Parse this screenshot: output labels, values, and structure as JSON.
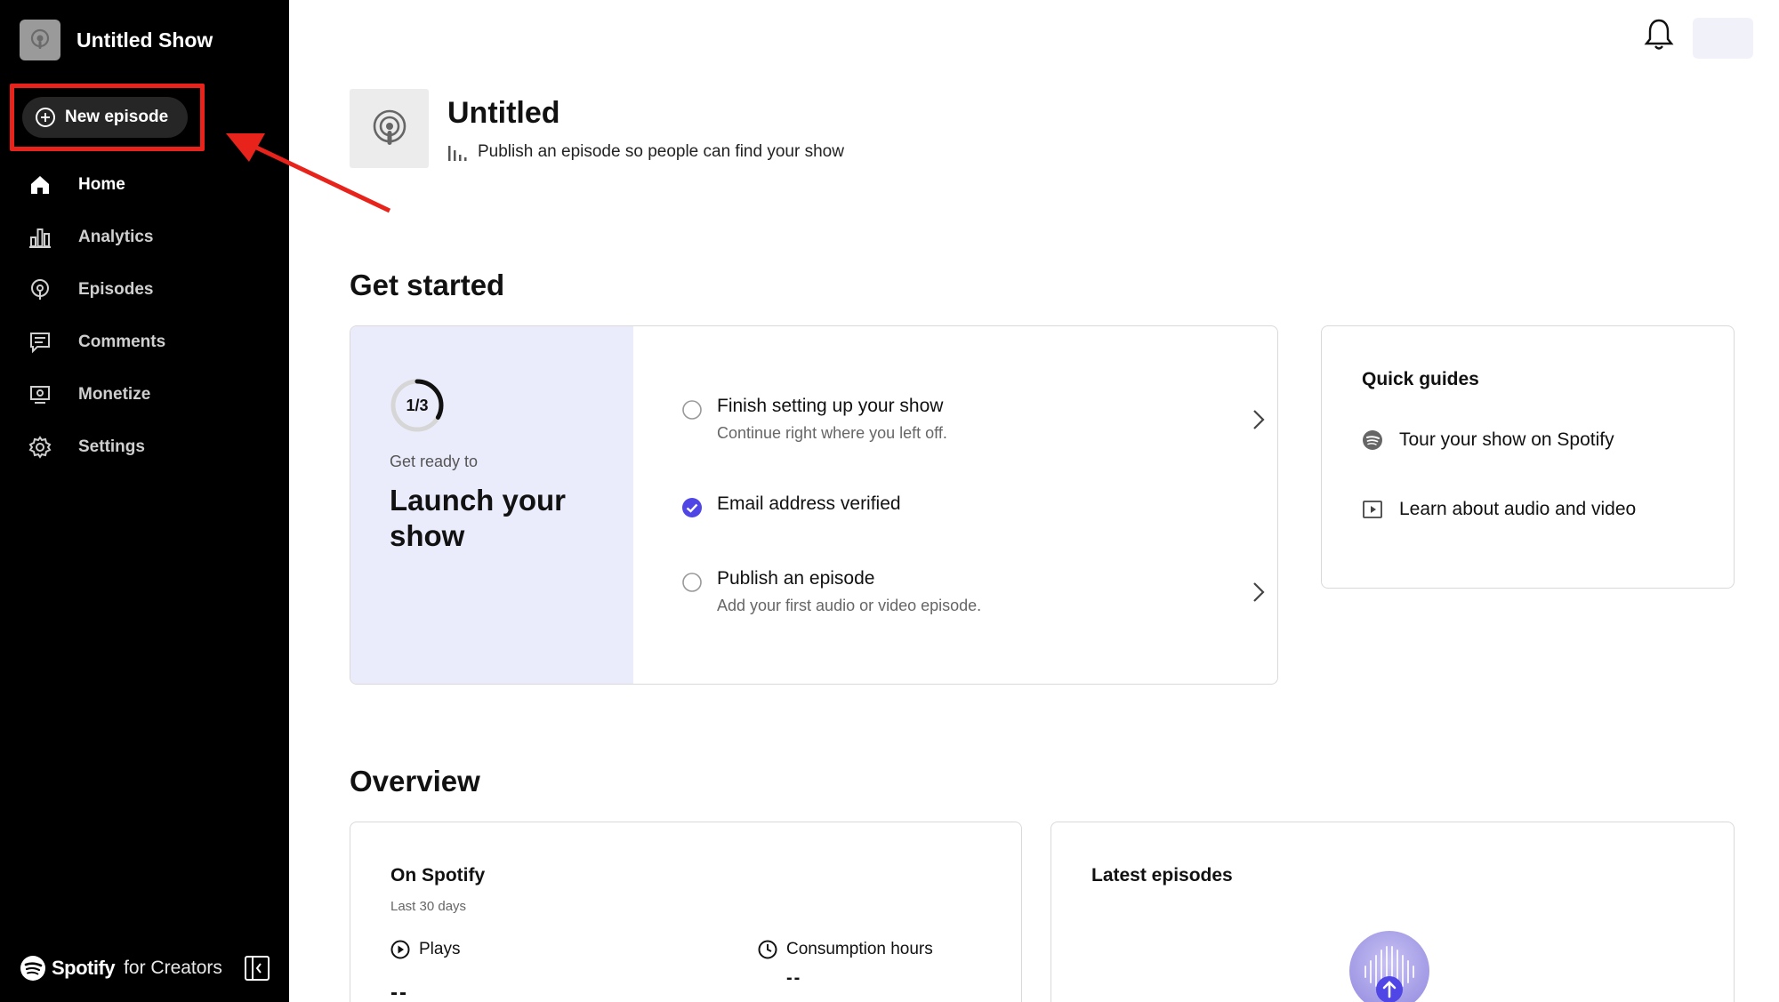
{
  "sidebar": {
    "show_title": "Untitled Show",
    "new_episode_label": "New episode",
    "items": [
      {
        "label": "Home",
        "icon": "home-icon",
        "active": true
      },
      {
        "label": "Analytics",
        "icon": "analytics-icon",
        "active": false
      },
      {
        "label": "Episodes",
        "icon": "episodes-icon",
        "active": false
      },
      {
        "label": "Comments",
        "icon": "comments-icon",
        "active": false
      },
      {
        "label": "Monetize",
        "icon": "monetize-icon",
        "active": false
      },
      {
        "label": "Settings",
        "icon": "gear-icon",
        "active": false
      }
    ],
    "brand_main": "Spotify",
    "brand_suffix": "for Creators"
  },
  "show": {
    "name": "Untitled",
    "status": "Publish an episode so people can find your show"
  },
  "get_started": {
    "title": "Get started",
    "progress": "1/3",
    "progress_fraction": 0.333,
    "kicker": "Get ready to",
    "heading": "Launch your show",
    "tasks": [
      {
        "title": "Finish setting up your show",
        "subtitle": "Continue right where you left off.",
        "done": false
      },
      {
        "title": "Email address verified",
        "subtitle": "",
        "done": true
      },
      {
        "title": "Publish an episode",
        "subtitle": "Add your first audio or video episode.",
        "done": false
      }
    ]
  },
  "quick_guides": {
    "title": "Quick guides",
    "items": [
      {
        "label": "Tour your show on Spotify",
        "icon": "spotify-icon"
      },
      {
        "label": "Learn about audio and video",
        "icon": "play-box-icon"
      }
    ]
  },
  "overview": {
    "title": "Overview",
    "on_spotify": {
      "title": "On Spotify",
      "subtitle": "Last 30 days",
      "plays_label": "Plays",
      "plays_value": "--",
      "hours_label": "Consumption hours",
      "hours_value": "--"
    },
    "latest": {
      "title": "Latest episodes"
    }
  },
  "colors": {
    "sidebar_bg": "#000000",
    "accent": "#4f46e5",
    "highlight": "#e8231b",
    "launch_panel": "#eaecfb"
  }
}
